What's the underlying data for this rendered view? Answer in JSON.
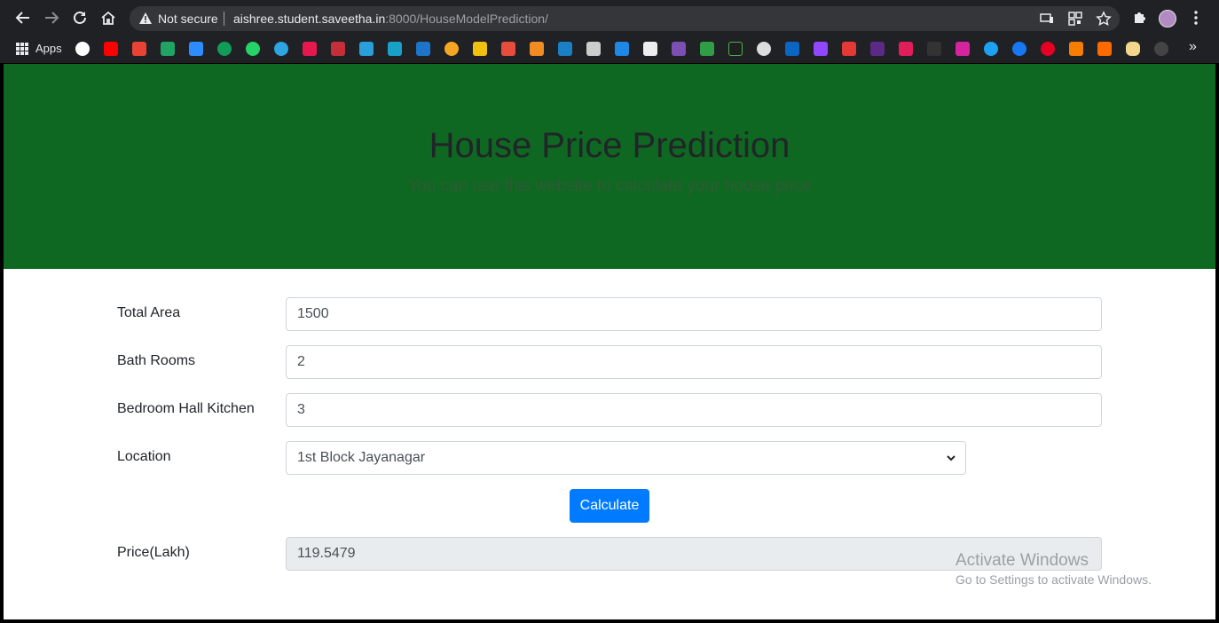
{
  "browser": {
    "status": "Not secure",
    "url_host": "aishree.student.saveetha.in",
    "url_rest": ":8000/HouseModelPrediction/",
    "apps_label": "Apps"
  },
  "hero": {
    "title": "House Price Prediction",
    "subtitle": "You can use this website to calculate your house price"
  },
  "form": {
    "total_area": {
      "label": "Total Area",
      "value": "1500"
    },
    "bath_rooms": {
      "label": "Bath Rooms",
      "value": "2"
    },
    "bhk": {
      "label": "Bedroom Hall Kitchen",
      "value": "3"
    },
    "location": {
      "label": "Location",
      "value": "1st Block Jayanagar"
    },
    "calculate_label": "Calculate",
    "price": {
      "label": "Price(Lakh)",
      "value": "119.5479"
    }
  },
  "watermark": {
    "title": "Activate Windows",
    "subtitle": "Go to Settings to activate Windows."
  },
  "colors": {
    "hero_bg": "#0f6821",
    "button": "#007bff"
  }
}
